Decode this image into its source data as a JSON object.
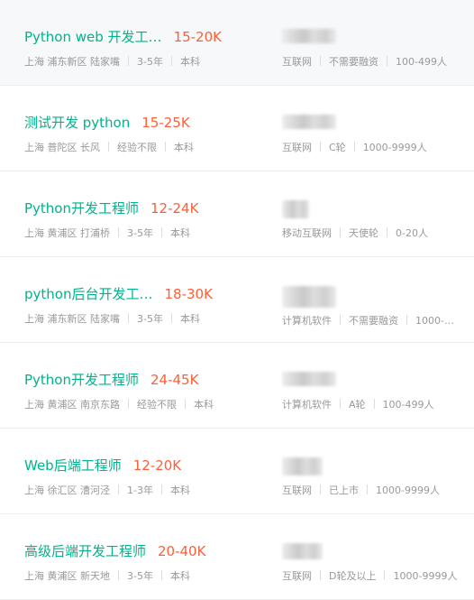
{
  "jobs": [
    {
      "title": "Python web 开发工…",
      "salary": "15-20K",
      "location": "上海 浦东新区 陆家嘴",
      "experience": "3-5年",
      "education": "本科",
      "industry": "互联网",
      "stage": "不需要融资",
      "size": "100-499人"
    },
    {
      "title": "测试开发 python",
      "salary": "15-25K",
      "location": "上海 普陀区 长风",
      "experience": "经验不限",
      "education": "本科",
      "industry": "互联网",
      "stage": "C轮",
      "size": "1000-9999人"
    },
    {
      "title": "Python开发工程师",
      "salary": "12-24K",
      "location": "上海 黄浦区 打浦桥",
      "experience": "3-5年",
      "education": "本科",
      "industry": "移动互联网",
      "stage": "天使轮",
      "size": "0-20人"
    },
    {
      "title": "python后台开发工…",
      "salary": "18-30K",
      "location": "上海 浦东新区 陆家嘴",
      "experience": "3-5年",
      "education": "本科",
      "industry": "计算机软件",
      "stage": "不需要融资",
      "size": "1000-…"
    },
    {
      "title": "Python开发工程师",
      "salary": "24-45K",
      "location": "上海 黄浦区 南京东路",
      "experience": "经验不限",
      "education": "本科",
      "industry": "计算机软件",
      "stage": "A轮",
      "size": "100-499人"
    },
    {
      "title": "Web后端工程师",
      "salary": "12-20K",
      "location": "上海 徐汇区 漕河泾",
      "experience": "1-3年",
      "education": "本科",
      "industry": "互联网",
      "stage": "已上市",
      "size": "1000-9999人"
    },
    {
      "title": "高级后端开发工程师",
      "salary": "20-40K",
      "location": "上海 黄浦区 新天地",
      "experience": "3-5年",
      "education": "本科",
      "industry": "互联网",
      "stage": "D轮及以上",
      "size": "1000-9999人"
    }
  ]
}
